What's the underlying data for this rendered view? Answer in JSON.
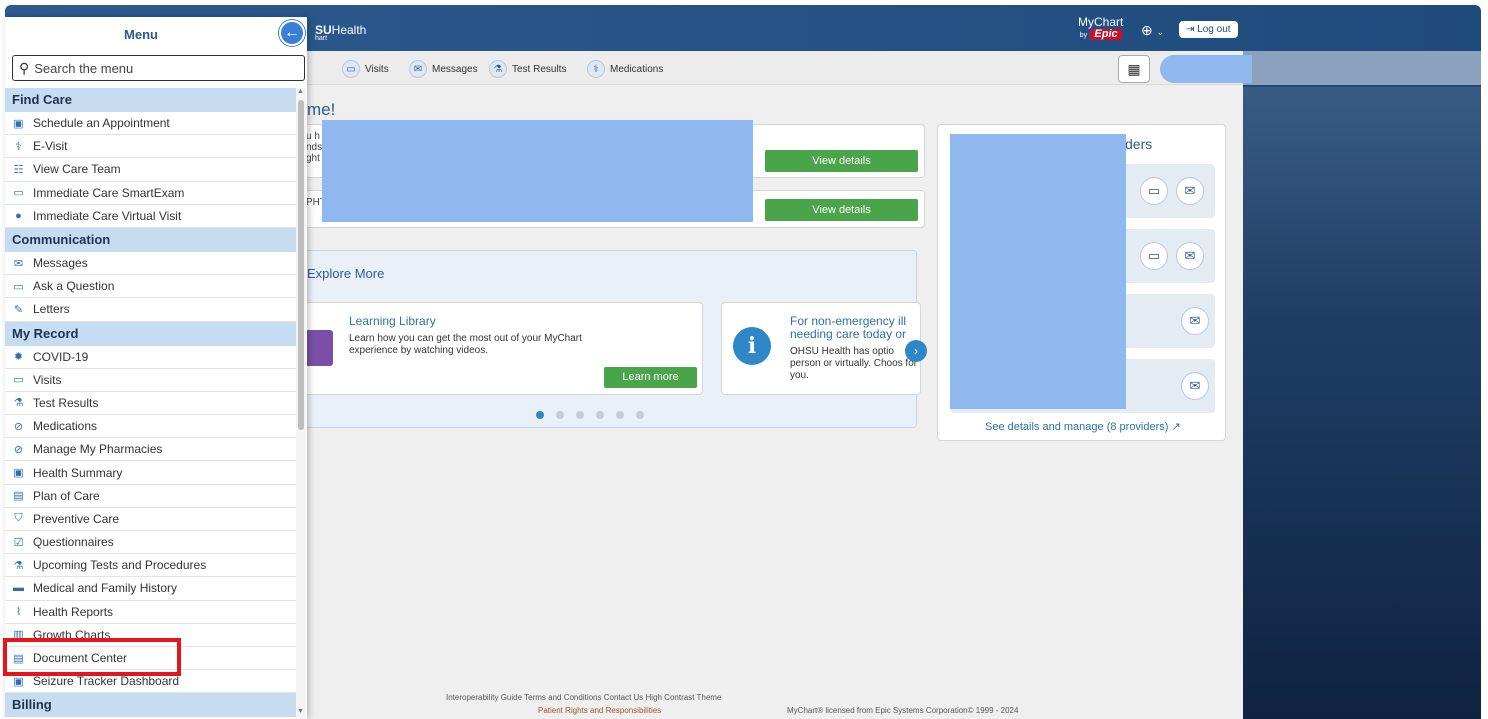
{
  "app": {
    "brand_prefix": "SU",
    "brand_suffix": "Health",
    "brand_sub": "hart",
    "mychart": "MyChart",
    "by": "by",
    "epic": "Epic",
    "logout": "Log out",
    "globe_caret": "⌄",
    "nav": [
      "Visits",
      "Messages",
      "Test Results",
      "Medications"
    ],
    "welcome": "me!",
    "peek_lines": [
      "u h",
      "nds",
      "ght",
      "PHT"
    ],
    "view_details": "View details",
    "explore_title": "Explore More",
    "learning_title": "Learning Library",
    "learning_text": "Learn how you can get the most out of your MyChart experience by watching videos.",
    "learn_more": "Learn more",
    "care_title": "For non-emergency ill needing care today or",
    "care_text": "OHSU Health has optio person or virtually. Choos for you.",
    "providers_title": "ders",
    "providers_link": "See details and manage (8 providers)",
    "footer_links": "Interoperability Guide  Terms and Conditions  Contact Us  High Contrast Theme",
    "footer_rights": "Patient Rights and Responsibilities",
    "footer_license": "MyChart® licensed from Epic Systems Corporation© 1999 - 2024"
  },
  "menu": {
    "title": "Menu",
    "search_placeholder": "Search the menu",
    "sections": [
      {
        "label": "Find Care",
        "items": [
          {
            "label": "Schedule an Appointment",
            "icon": "calendar-plus-icon"
          },
          {
            "label": "E-Visit",
            "icon": "stethoscope-icon"
          },
          {
            "label": "View Care Team",
            "icon": "care-team-icon"
          },
          {
            "label": "Immediate Care SmartExam",
            "icon": "chat-bubble-icon"
          },
          {
            "label": "Immediate Care Virtual Visit",
            "icon": "video-icon"
          }
        ]
      },
      {
        "label": "Communication",
        "items": [
          {
            "label": "Messages",
            "icon": "envelope-icon"
          },
          {
            "label": "Ask a Question",
            "icon": "chat-bubble-icon"
          },
          {
            "label": "Letters",
            "icon": "letter-icon"
          }
        ]
      },
      {
        "label": "My Record",
        "items": [
          {
            "label": "COVID-19",
            "icon": "virus-icon"
          },
          {
            "label": "Visits",
            "icon": "calendar-icon"
          },
          {
            "label": "Test Results",
            "icon": "flask-icon"
          },
          {
            "label": "Medications",
            "icon": "pill-icon"
          },
          {
            "label": "Manage My Pharmacies",
            "icon": "pill-icon"
          },
          {
            "label": "Health Summary",
            "icon": "heart-doc-icon"
          },
          {
            "label": "Plan of Care",
            "icon": "clipboard-icon"
          },
          {
            "label": "Preventive Care",
            "icon": "shield-icon"
          },
          {
            "label": "Questionnaires",
            "icon": "checklist-icon"
          },
          {
            "label": "Upcoming Tests and Procedures",
            "icon": "flask-clock-icon"
          },
          {
            "label": "Medical and Family History",
            "icon": "folder-icon"
          },
          {
            "label": "Health Reports",
            "icon": "chart-icon"
          },
          {
            "label": "Growth Charts",
            "icon": "growth-chart-icon"
          },
          {
            "label": "Document Center",
            "icon": "document-icon"
          },
          {
            "label": "Seizure Tracker Dashboard",
            "icon": "heart-doc-icon"
          }
        ]
      },
      {
        "label": "Billing",
        "items": []
      }
    ]
  },
  "colors": {
    "highlight": "#e8141d",
    "section_bg": "#c6dcf1",
    "accent": "#2d5b8f"
  }
}
